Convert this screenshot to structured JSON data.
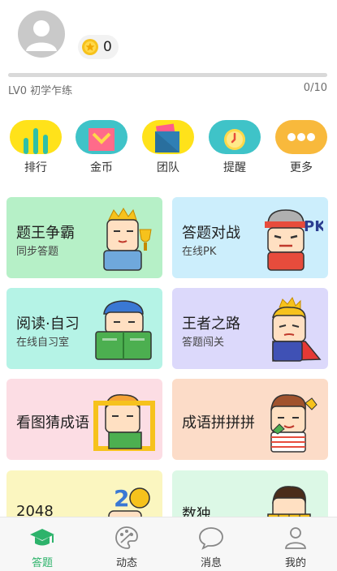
{
  "profile": {
    "coin_count": "0",
    "level_text": "LV0 初学乍练",
    "progress_text": "0/10",
    "progress_fraction": 0.0
  },
  "shortcuts": [
    {
      "label": "排行",
      "icon": "ranking-bars-icon",
      "color": "#ffe21a"
    },
    {
      "label": "金币",
      "icon": "coin-envelope-icon",
      "color": "#3fc3c8"
    },
    {
      "label": "团队",
      "icon": "team-flag-icon",
      "color": "#ffe21a"
    },
    {
      "label": "提醒",
      "icon": "alarm-clock-icon",
      "color": "#3fc3c8"
    },
    {
      "label": "更多",
      "icon": "more-dots-icon",
      "color": "#f8b93c"
    }
  ],
  "cards": [
    {
      "title": "题王争霸",
      "subtitle": "同步答题",
      "color": "#b6f0c7",
      "icon": "trophy-character-icon"
    },
    {
      "title": "答题对战",
      "subtitle": "在线PK",
      "color": "#cceefc",
      "icon": "pk-fighter-character-icon"
    },
    {
      "title": "阅读·自习",
      "subtitle": "在线自习室",
      "color": "#b5f3e6",
      "icon": "reading-book-character-icon"
    },
    {
      "title": "王者之路",
      "subtitle": "答题闯关",
      "color": "#dcd9fb",
      "icon": "king-caped-character-icon"
    },
    {
      "title": "看图猜成语",
      "subtitle": "",
      "color": "#fcdde4",
      "icon": "picture-frame-character-icon"
    },
    {
      "title": "成语拼拼拼",
      "subtitle": "",
      "color": "#fcdcc8",
      "icon": "puzzle-character-icon"
    },
    {
      "title": "2048",
      "subtitle": "",
      "color": "#fbf6c0",
      "icon": "number-2048-character-icon"
    },
    {
      "title": "数独",
      "subtitle": "",
      "color": "#dcf8e6",
      "icon": "sudoku-character-icon"
    }
  ],
  "tabs": [
    {
      "label": "答题",
      "icon": "graduation-cap-icon",
      "active": true
    },
    {
      "label": "动态",
      "icon": "palette-icon",
      "active": false
    },
    {
      "label": "消息",
      "icon": "chat-bubble-icon",
      "active": false
    },
    {
      "label": "我的",
      "icon": "person-icon",
      "active": false
    }
  ],
  "colors": {
    "accent": "#2db36b",
    "progress_track": "#d9d9d9",
    "coin": "#f6c21c"
  }
}
